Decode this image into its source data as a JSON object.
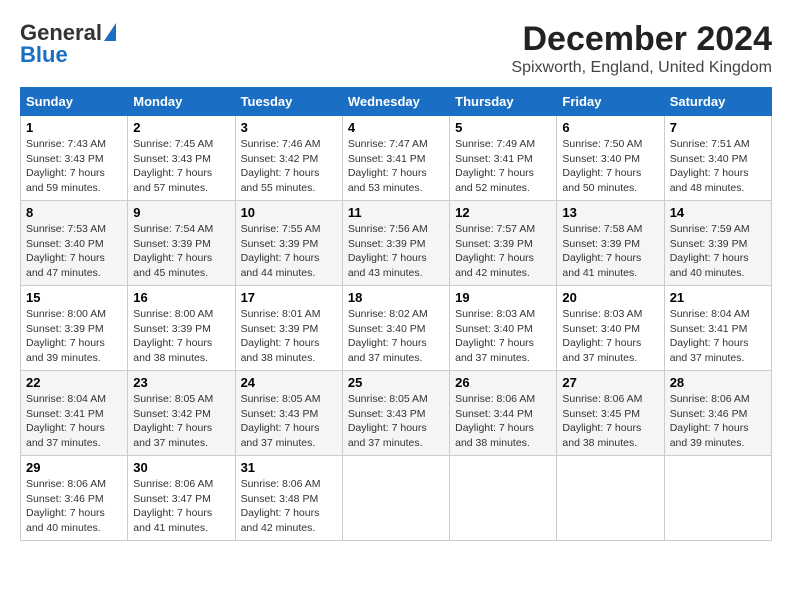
{
  "logo": {
    "line1": "General",
    "line2": "Blue"
  },
  "title": "December 2024",
  "subtitle": "Spixworth, England, United Kingdom",
  "days_of_week": [
    "Sunday",
    "Monday",
    "Tuesday",
    "Wednesday",
    "Thursday",
    "Friday",
    "Saturday"
  ],
  "weeks": [
    [
      {
        "day": 1,
        "sunrise": "7:43 AM",
        "sunset": "3:43 PM",
        "daylight": "7 hours and 59 minutes."
      },
      {
        "day": 2,
        "sunrise": "7:45 AM",
        "sunset": "3:43 PM",
        "daylight": "7 hours and 57 minutes."
      },
      {
        "day": 3,
        "sunrise": "7:46 AM",
        "sunset": "3:42 PM",
        "daylight": "7 hours and 55 minutes."
      },
      {
        "day": 4,
        "sunrise": "7:47 AM",
        "sunset": "3:41 PM",
        "daylight": "7 hours and 53 minutes."
      },
      {
        "day": 5,
        "sunrise": "7:49 AM",
        "sunset": "3:41 PM",
        "daylight": "7 hours and 52 minutes."
      },
      {
        "day": 6,
        "sunrise": "7:50 AM",
        "sunset": "3:40 PM",
        "daylight": "7 hours and 50 minutes."
      },
      {
        "day": 7,
        "sunrise": "7:51 AM",
        "sunset": "3:40 PM",
        "daylight": "7 hours and 48 minutes."
      }
    ],
    [
      {
        "day": 8,
        "sunrise": "7:53 AM",
        "sunset": "3:40 PM",
        "daylight": "7 hours and 47 minutes."
      },
      {
        "day": 9,
        "sunrise": "7:54 AM",
        "sunset": "3:39 PM",
        "daylight": "7 hours and 45 minutes."
      },
      {
        "day": 10,
        "sunrise": "7:55 AM",
        "sunset": "3:39 PM",
        "daylight": "7 hours and 44 minutes."
      },
      {
        "day": 11,
        "sunrise": "7:56 AM",
        "sunset": "3:39 PM",
        "daylight": "7 hours and 43 minutes."
      },
      {
        "day": 12,
        "sunrise": "7:57 AM",
        "sunset": "3:39 PM",
        "daylight": "7 hours and 42 minutes."
      },
      {
        "day": 13,
        "sunrise": "7:58 AM",
        "sunset": "3:39 PM",
        "daylight": "7 hours and 41 minutes."
      },
      {
        "day": 14,
        "sunrise": "7:59 AM",
        "sunset": "3:39 PM",
        "daylight": "7 hours and 40 minutes."
      }
    ],
    [
      {
        "day": 15,
        "sunrise": "8:00 AM",
        "sunset": "3:39 PM",
        "daylight": "7 hours and 39 minutes."
      },
      {
        "day": 16,
        "sunrise": "8:00 AM",
        "sunset": "3:39 PM",
        "daylight": "7 hours and 38 minutes."
      },
      {
        "day": 17,
        "sunrise": "8:01 AM",
        "sunset": "3:39 PM",
        "daylight": "7 hours and 38 minutes."
      },
      {
        "day": 18,
        "sunrise": "8:02 AM",
        "sunset": "3:40 PM",
        "daylight": "7 hours and 37 minutes."
      },
      {
        "day": 19,
        "sunrise": "8:03 AM",
        "sunset": "3:40 PM",
        "daylight": "7 hours and 37 minutes."
      },
      {
        "day": 20,
        "sunrise": "8:03 AM",
        "sunset": "3:40 PM",
        "daylight": "7 hours and 37 minutes."
      },
      {
        "day": 21,
        "sunrise": "8:04 AM",
        "sunset": "3:41 PM",
        "daylight": "7 hours and 37 minutes."
      }
    ],
    [
      {
        "day": 22,
        "sunrise": "8:04 AM",
        "sunset": "3:41 PM",
        "daylight": "7 hours and 37 minutes."
      },
      {
        "day": 23,
        "sunrise": "8:05 AM",
        "sunset": "3:42 PM",
        "daylight": "7 hours and 37 minutes."
      },
      {
        "day": 24,
        "sunrise": "8:05 AM",
        "sunset": "3:43 PM",
        "daylight": "7 hours and 37 minutes."
      },
      {
        "day": 25,
        "sunrise": "8:05 AM",
        "sunset": "3:43 PM",
        "daylight": "7 hours and 37 minutes."
      },
      {
        "day": 26,
        "sunrise": "8:06 AM",
        "sunset": "3:44 PM",
        "daylight": "7 hours and 38 minutes."
      },
      {
        "day": 27,
        "sunrise": "8:06 AM",
        "sunset": "3:45 PM",
        "daylight": "7 hours and 38 minutes."
      },
      {
        "day": 28,
        "sunrise": "8:06 AM",
        "sunset": "3:46 PM",
        "daylight": "7 hours and 39 minutes."
      }
    ],
    [
      {
        "day": 29,
        "sunrise": "8:06 AM",
        "sunset": "3:46 PM",
        "daylight": "7 hours and 40 minutes."
      },
      {
        "day": 30,
        "sunrise": "8:06 AM",
        "sunset": "3:47 PM",
        "daylight": "7 hours and 41 minutes."
      },
      {
        "day": 31,
        "sunrise": "8:06 AM",
        "sunset": "3:48 PM",
        "daylight": "7 hours and 42 minutes."
      },
      null,
      null,
      null,
      null
    ]
  ]
}
